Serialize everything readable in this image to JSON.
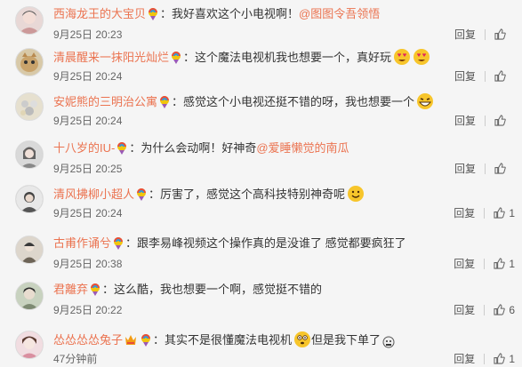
{
  "comments": [
    {
      "user": "西海龙王的大宝贝",
      "text": "：我好喜欢这个小电视啊！",
      "mention": "@图图令吾领悟",
      "emojis": [],
      "time": "9月25日 20:23",
      "reply": "回复",
      "likes": "",
      "avatar_color": "#e8d8d6"
    },
    {
      "user": "清晨醒来一抹阳光灿烂",
      "text": "：这个魔法电视机我也想要一个，真好玩",
      "mention": "",
      "emojis": [
        "heart-eyes-icon",
        "heart-eyes-icon"
      ],
      "time": "9月25日 20:24",
      "reply": "回复",
      "likes": "",
      "avatar_color": "#d8c9a8"
    },
    {
      "user": "安妮熊的三明治公寓",
      "text": "：感觉这个小电视还挺不错的呀，我也想要一个",
      "mention": "",
      "emojis": [
        "grin-icon"
      ],
      "time": "9月25日 20:24",
      "reply": "回复",
      "likes": "",
      "avatar_color": "#e6e0cf"
    },
    {
      "user": "十八岁的IU-",
      "text": "：为什么会动啊！好神奇",
      "mention": "@爱睡懒觉的南瓜",
      "emojis": [],
      "time": "9月25日 20:25",
      "reply": "回复",
      "likes": "",
      "avatar_color": "#bfbfbf"
    },
    {
      "user": "清风拂柳小超人",
      "text": "：厉害了，感觉这个高科技特别神奇呢",
      "mention": "",
      "emojis": [
        "smile-icon"
      ],
      "time": "9月25日 20:24",
      "reply": "回复",
      "likes": "1",
      "avatar_color": "#a8a8a8"
    },
    {
      "user": "古甫作诵兮",
      "text": "：跟李易峰视频这个操作真的是没谁了 感觉都要疯狂了",
      "mention": "",
      "emojis": [],
      "time": "9月25日 20:38",
      "reply": "回复",
      "likes": "1",
      "avatar_color": "#cfc8bf"
    },
    {
      "user": "君離弃",
      "text": "：这么酷，我也想要一个啊，感觉挺不错的",
      "mention": "",
      "emojis": [],
      "time": "9月25日 20:22",
      "reply": "回复",
      "likes": "6",
      "avatar_color": "#b9c4b0"
    },
    {
      "user": "怂怂怂怂兔子",
      "text": "：其实不是很懂魔法电视机",
      "text2": "但是我下单了",
      "mention": "",
      "emojis": [
        "flushed-icon"
      ],
      "time": "47分钟前",
      "reply": "回复",
      "likes": "1",
      "avatar_color": "#e3c9cf"
    }
  ]
}
